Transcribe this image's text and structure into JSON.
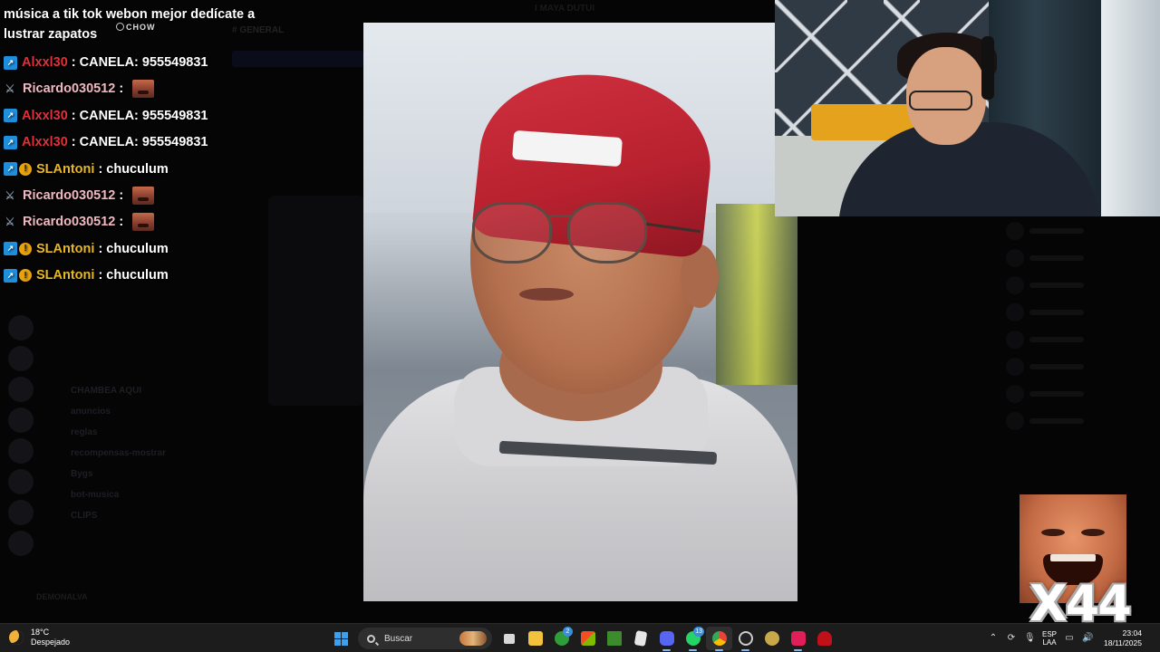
{
  "chat": {
    "top_message": "música a tik tok webon mejor dedícate a lustrar zapatos",
    "top_badge": "CHOW",
    "messages": [
      {
        "user": "Alxxl30",
        "color": "#e0303a",
        "badges": [
          "kick"
        ],
        "text": "CANELA: 955549831",
        "emote": false
      },
      {
        "user": "Ricardo030512",
        "color": "#f0b8c0",
        "badges": [
          "mod"
        ],
        "text": "",
        "emote": true
      },
      {
        "user": "Alxxl30",
        "color": "#e0303a",
        "badges": [
          "kick"
        ],
        "text": "CANELA: 955549831",
        "emote": false
      },
      {
        "user": "Alxxl30",
        "color": "#e0303a",
        "badges": [
          "kick"
        ],
        "text": "CANELA: 955549831",
        "emote": false
      },
      {
        "user": "SLAntoni",
        "color": "#e8b820",
        "badges": [
          "kick",
          "sub"
        ],
        "text": "chuculum",
        "emote": false
      },
      {
        "user": "Ricardo030512",
        "color": "#f0b8c0",
        "badges": [
          "mod"
        ],
        "text": "",
        "emote": true
      },
      {
        "user": "Ricardo030512",
        "color": "#f0b8c0",
        "badges": [
          "mod"
        ],
        "text": "",
        "emote": true
      },
      {
        "user": "SLAntoni",
        "color": "#e8b820",
        "badges": [
          "kick",
          "sub"
        ],
        "text": "chuculum",
        "emote": false
      },
      {
        "user": "SLAntoni",
        "color": "#e8b820",
        "badges": [
          "kick",
          "sub"
        ],
        "text": "chuculum",
        "emote": false
      }
    ]
  },
  "background_app": {
    "top_name": "I MAYA DUTUI",
    "channel_header": "# GENERAL",
    "channels": [
      "CHAMBEA AQUI",
      "anuncios",
      "reglas",
      "recompensas-mostrar",
      "Bygs",
      "bot-musica",
      "CLIPS"
    ],
    "bottom_user": "DEMONALVA"
  },
  "reaction": {
    "multiplier": "X44"
  },
  "taskbar": {
    "weather_temp": "18°C",
    "weather_desc": "Despejado",
    "search_placeholder": "Buscar",
    "xbox_badge": "2",
    "whatsapp_badge": "13",
    "lang_line1": "ESP",
    "lang_line2": "LAA",
    "time": "23:04",
    "date": "18/11/2025"
  },
  "icons": {
    "kick_badge": "kick-icon",
    "mod_badge": "sword-icon",
    "sub_badge": "exclamation-icon",
    "weather": "moon-icon"
  }
}
